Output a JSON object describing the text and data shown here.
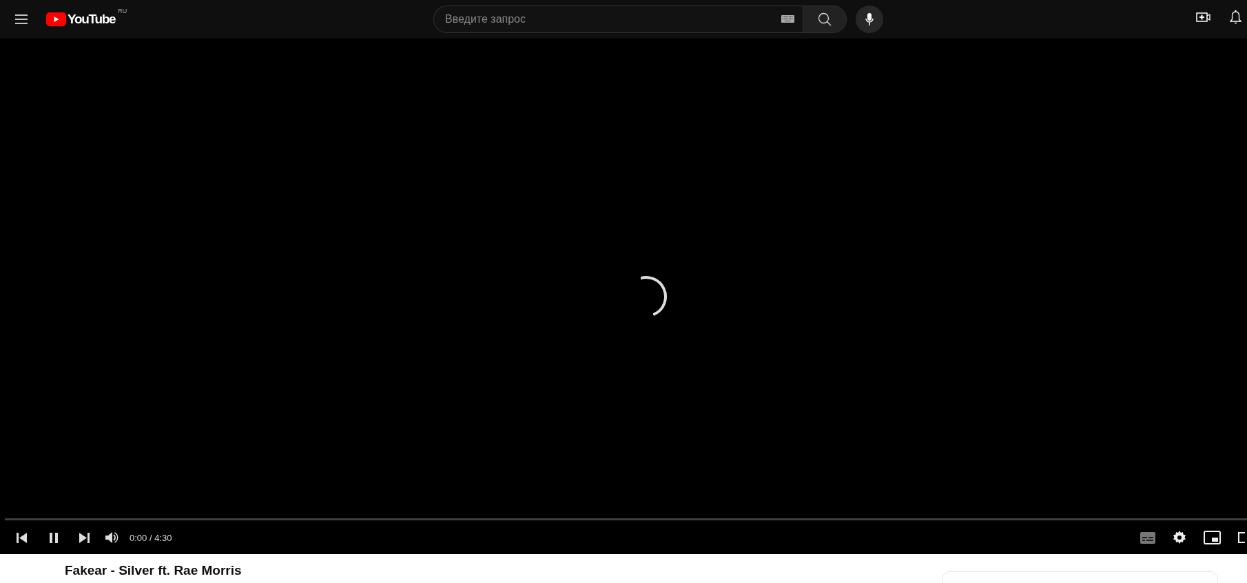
{
  "header": {
    "logo": {
      "wordmark": "YouTube",
      "region": "RU"
    },
    "search": {
      "placeholder": "Введите запрос"
    }
  },
  "player": {
    "loading": true,
    "progress": {
      "level": 0
    },
    "playing": true,
    "time": "0:00 / 4:30",
    "captions_on": false
  },
  "video": {
    "title": "Fakear - Silver ft. Rae Morris"
  }
}
